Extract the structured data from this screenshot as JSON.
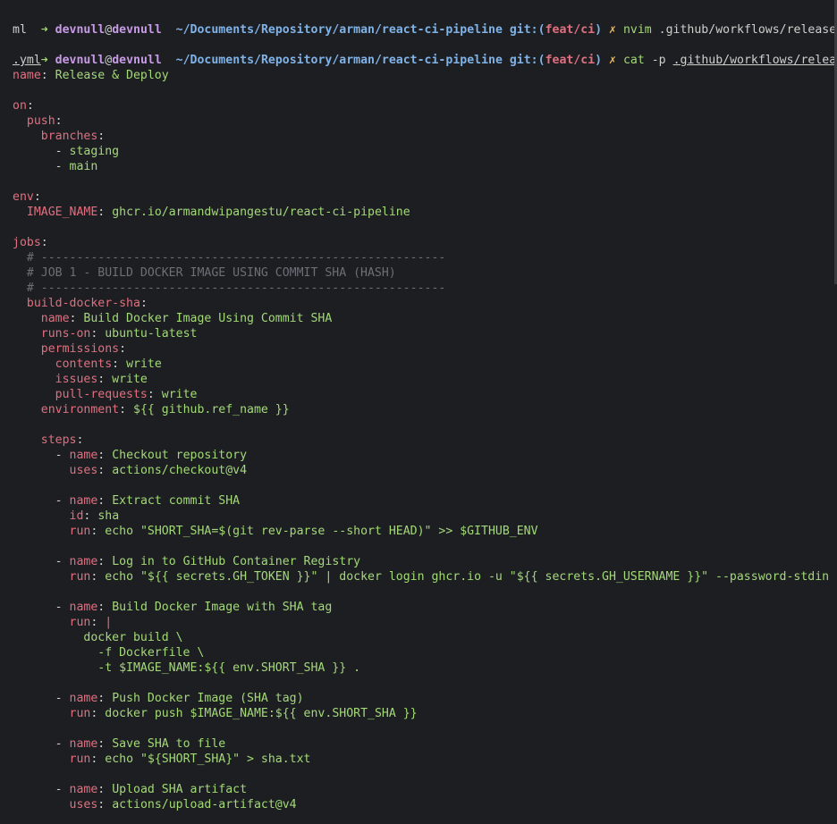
{
  "prompt1": {
    "arrow": "➜",
    "user": "devnull",
    "at": "@",
    "host": "devnull",
    "path": "~/Documents/Repository/arman/react-ci-pipeline",
    "git_label": "git:(",
    "branch": "feat/ci",
    "git_close": ")",
    "dirty": "✗",
    "command": "nvim",
    "arg": ".github/workflows/release.y",
    "arg_wrap": "ml"
  },
  "prompt2": {
    "arrow": "➜",
    "user": "devnull",
    "at": "@",
    "host": "devnull",
    "path": "~/Documents/Repository/arman/react-ci-pipeline",
    "git_label": "git:(",
    "branch": "feat/ci",
    "git_close": ")",
    "dirty": "✗",
    "command": "cat",
    "flag": "-p",
    "arg": ".github/workflows/release",
    "arg_wrap": ".yml"
  },
  "yaml": [
    {
      "type": "kv",
      "indent": "",
      "key": "name",
      "value": "Release & Deploy"
    },
    {
      "type": "blank"
    },
    {
      "type": "key",
      "indent": "",
      "key": "on"
    },
    {
      "type": "key",
      "indent": "  ",
      "key": "push"
    },
    {
      "type": "key",
      "indent": "    ",
      "key": "branches"
    },
    {
      "type": "item",
      "indent": "      ",
      "value": "staging"
    },
    {
      "type": "item",
      "indent": "      ",
      "value": "main"
    },
    {
      "type": "blank"
    },
    {
      "type": "key",
      "indent": "",
      "key": "env"
    },
    {
      "type": "kv",
      "indent": "  ",
      "key": "IMAGE_NAME",
      "value": "ghcr.io/armandwipangestu/react-ci-pipeline"
    },
    {
      "type": "blank"
    },
    {
      "type": "key",
      "indent": "",
      "key": "jobs"
    },
    {
      "type": "comment",
      "indent": "  ",
      "value": "# ---------------------------------------------------------"
    },
    {
      "type": "comment",
      "indent": "  ",
      "value": "# JOB 1 - BUILD DOCKER IMAGE USING COMMIT SHA (HASH)"
    },
    {
      "type": "comment",
      "indent": "  ",
      "value": "# ---------------------------------------------------------"
    },
    {
      "type": "key",
      "indent": "  ",
      "key": "build-docker-sha"
    },
    {
      "type": "kv",
      "indent": "    ",
      "key": "name",
      "value": "Build Docker Image Using Commit SHA"
    },
    {
      "type": "kv",
      "indent": "    ",
      "key": "runs-on",
      "value": "ubuntu-latest"
    },
    {
      "type": "key",
      "indent": "    ",
      "key": "permissions"
    },
    {
      "type": "kv",
      "indent": "      ",
      "key": "contents",
      "value": "write"
    },
    {
      "type": "kv",
      "indent": "      ",
      "key": "issues",
      "value": "write"
    },
    {
      "type": "kv",
      "indent": "      ",
      "key": "pull-requests",
      "value": "write"
    },
    {
      "type": "kv",
      "indent": "    ",
      "key": "environment",
      "value": "${{ github.ref_name }}"
    },
    {
      "type": "blank"
    },
    {
      "type": "key",
      "indent": "    ",
      "key": "steps"
    },
    {
      "type": "dashkv",
      "indent": "      ",
      "key": "name",
      "value": "Checkout repository"
    },
    {
      "type": "kv",
      "indent": "        ",
      "key": "uses",
      "value": "actions/checkout@v4"
    },
    {
      "type": "blank"
    },
    {
      "type": "dashkv",
      "indent": "      ",
      "key": "name",
      "value": "Extract commit SHA"
    },
    {
      "type": "kv",
      "indent": "        ",
      "key": "id",
      "value": "sha"
    },
    {
      "type": "kv",
      "indent": "        ",
      "key": "run",
      "value": "echo \"SHORT_SHA=$(git rev-parse --short HEAD)\" >> $GITHUB_ENV"
    },
    {
      "type": "blank"
    },
    {
      "type": "dashkv",
      "indent": "      ",
      "key": "name",
      "value": "Log in to GitHub Container Registry"
    },
    {
      "type": "kv",
      "indent": "        ",
      "key": "run",
      "value": "echo \"${{ secrets.GH_TOKEN }}\" | docker login ghcr.io -u \"${{ secrets.GH_USERNAME }}\" --password-stdin"
    },
    {
      "type": "blank"
    },
    {
      "type": "dashkv",
      "indent": "      ",
      "key": "name",
      "value": "Build Docker Image with SHA tag"
    },
    {
      "type": "kv",
      "indent": "        ",
      "key": "run",
      "value": "|",
      "valueClass": "k"
    },
    {
      "type": "text",
      "indent": "          ",
      "value": "docker build \\"
    },
    {
      "type": "text",
      "indent": "            ",
      "value": "-f Dockerfile \\"
    },
    {
      "type": "text",
      "indent": "            ",
      "value": "-t $IMAGE_NAME:${{ env.SHORT_SHA }} ."
    },
    {
      "type": "blank"
    },
    {
      "type": "dashkv",
      "indent": "      ",
      "key": "name",
      "value": "Push Docker Image (SHA tag)"
    },
    {
      "type": "kv",
      "indent": "        ",
      "key": "run",
      "value": "docker push $IMAGE_NAME:${{ env.SHORT_SHA }}"
    },
    {
      "type": "blank"
    },
    {
      "type": "dashkv",
      "indent": "      ",
      "key": "name",
      "value": "Save SHA to file"
    },
    {
      "type": "kv",
      "indent": "        ",
      "key": "run",
      "value": "echo \"${SHORT_SHA}\" > sha.txt"
    },
    {
      "type": "blank"
    },
    {
      "type": "dashkv",
      "indent": "      ",
      "key": "name",
      "value": "Upload SHA artifact"
    },
    {
      "type": "kv",
      "indent": "        ",
      "key": "uses",
      "value": "actions/upload-artifact@v4"
    }
  ]
}
